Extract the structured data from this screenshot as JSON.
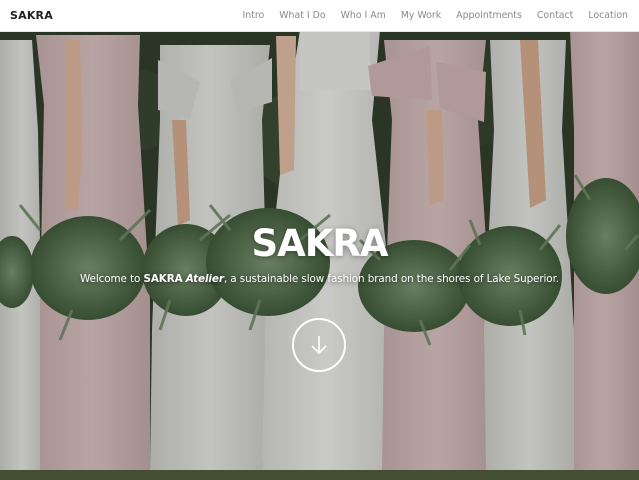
{
  "brand": "SAKRA",
  "nav": {
    "items": [
      {
        "label": "Intro"
      },
      {
        "label": "What I Do"
      },
      {
        "label": "Who I Am"
      },
      {
        "label": "My Work"
      },
      {
        "label": "Appointments"
      },
      {
        "label": "Contact"
      },
      {
        "label": "Location"
      }
    ]
  },
  "hero": {
    "title": "SAKRA",
    "tagline_prefix": "Welcome to ",
    "tagline_brand": "SAKRA",
    "tagline_brand_suffix": "Atelier",
    "tagline_rest": ", a sustainable slow fashion brand on the shores of Lake Superior.",
    "scroll_icon": "arrow-down-icon"
  },
  "colors": {
    "nav_bg": "#ffffff",
    "brand_text": "#222222",
    "nav_text": "#8a8a8a",
    "hero_text": "#ffffff",
    "dress_blush": "#d8c0c0",
    "dress_ivory": "#e6e6e3",
    "foliage": "#5d7a55"
  }
}
